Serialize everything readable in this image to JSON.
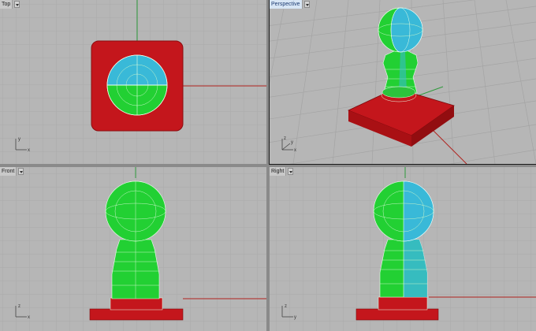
{
  "colors": {
    "grid_bg": "#b6b6b6",
    "grid_line": "#a6a6a6",
    "grid_major": "#9c9c9c",
    "axis_red": "#b0221f",
    "axis_green": "#2f9a3c",
    "model_green": "#22d033",
    "model_cyan": "#39b9d8",
    "base_red": "#c4161c",
    "edge_white": "#e8ffe8"
  },
  "viewports": {
    "top": {
      "title": "Top",
      "axis_x": "x",
      "axis_y": "y"
    },
    "perspective": {
      "title": "Perspective",
      "axis_x": "x",
      "axis_y": "y",
      "axis_z": "z"
    },
    "front": {
      "title": "Front",
      "axis_x": "x",
      "axis_y": "z"
    },
    "right": {
      "title": "Right",
      "axis_x": "y",
      "axis_y": "z"
    }
  }
}
